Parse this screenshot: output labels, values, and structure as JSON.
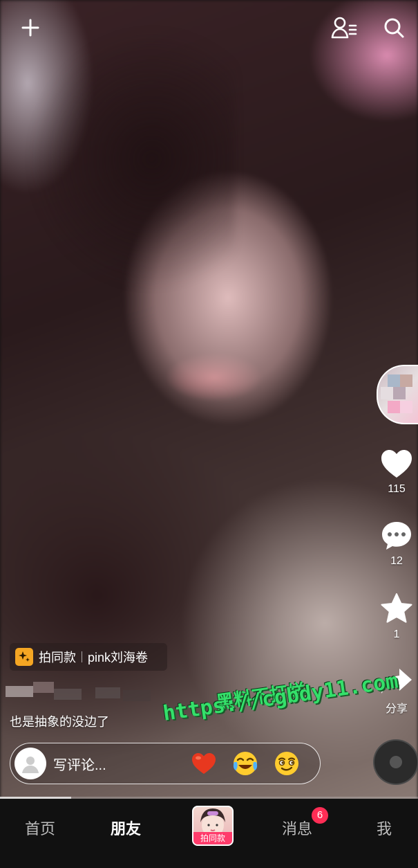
{
  "video": {
    "caption": "也是抽象的没边了",
    "template_chip": {
      "label": "拍同款",
      "name": "pink刘海卷"
    }
  },
  "actions": {
    "likes": "115",
    "comments": "12",
    "favorites": "1",
    "share_label": "分享"
  },
  "comment_bar": {
    "placeholder": "写评论...",
    "emojis": [
      "heart-emoji",
      "laugh-cry-emoji",
      "smirk-emoji"
    ]
  },
  "watermark": {
    "title": "黑料不打烊",
    "url": "https://cgbdy11.com"
  },
  "bottom_nav": {
    "home": "首页",
    "friends": "朋友",
    "center_label": "拍同款",
    "messages": "消息",
    "messages_badge": "6",
    "me": "我"
  },
  "playback_progress": 0.17,
  "colors": {
    "like": "#ffffff",
    "badge": "#ff2d55",
    "chip_icon": "#f5a623",
    "watermark": "#34e06a"
  }
}
